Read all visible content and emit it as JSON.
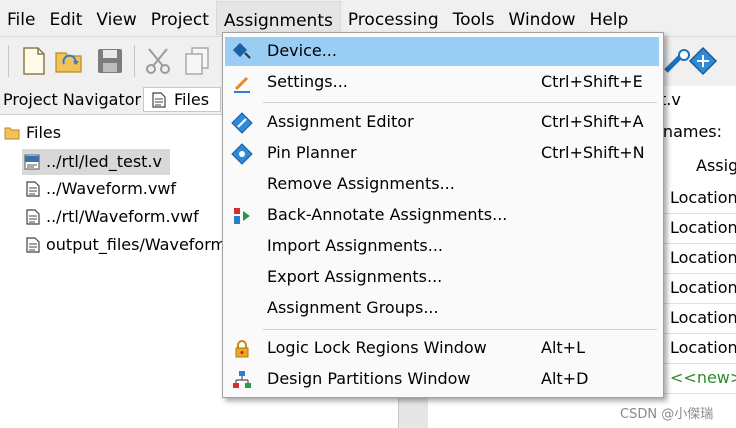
{
  "menubar": {
    "items": [
      "File",
      "Edit",
      "View",
      "Project",
      "Assignments",
      "Processing",
      "Tools",
      "Window",
      "Help"
    ]
  },
  "navigator": {
    "title": "Project Navigator",
    "tab_label": "Files",
    "folder": "Files",
    "files": [
      "../rtl/led_test.v",
      "../Waveform.vwf",
      "../rtl/Waveform.vwf",
      "output_files/Waveform"
    ]
  },
  "right_pane": {
    "tab_fragment": "t.v",
    "names_label": "e names:",
    "column_header": "Assig",
    "rows": [
      "Location",
      "Location",
      "Location",
      "Location",
      "Location",
      "Location"
    ],
    "new_row": "<<new>>"
  },
  "dropdown": {
    "group1": [
      {
        "label": "Device...",
        "shortcut": "",
        "icon": "chip-icon"
      },
      {
        "label": "Settings...",
        "shortcut": "Ctrl+Shift+E",
        "icon": "pencil-icon"
      }
    ],
    "group2": [
      {
        "label": "Assignment Editor",
        "shortcut": "Ctrl+Shift+A",
        "icon": "assignment-editor-icon"
      },
      {
        "label": "Pin Planner",
        "shortcut": "Ctrl+Shift+N",
        "icon": "pin-planner-icon"
      },
      {
        "label": "Remove Assignments...",
        "shortcut": "",
        "icon": ""
      },
      {
        "label": "Back-Annotate Assignments...",
        "shortcut": "",
        "icon": "back-annotate-icon"
      },
      {
        "label": "Import Assignments...",
        "shortcut": "",
        "icon": ""
      },
      {
        "label": "Export Assignments...",
        "shortcut": "",
        "icon": ""
      },
      {
        "label": "Assignment Groups...",
        "shortcut": "",
        "icon": ""
      }
    ],
    "group3": [
      {
        "label": "Logic Lock Regions Window",
        "shortcut": "Alt+L",
        "icon": "lock-icon"
      },
      {
        "label": "Design Partitions Window",
        "shortcut": "Alt+D",
        "icon": "partition-icon"
      }
    ]
  },
  "watermark": "CSDN @小傑瑞",
  "colors": {
    "highlight": "#99cdf3",
    "new_row": "#2e8b2e"
  }
}
